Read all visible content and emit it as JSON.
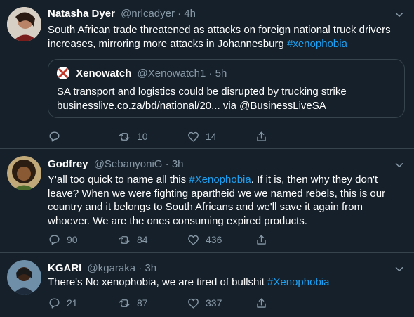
{
  "tweets": [
    {
      "name": "Natasha Dyer",
      "handle": "@nrlcadyer",
      "dot": "·",
      "time": "4h",
      "text_plain": "South African trade threatened as attacks on foreign national truck drivers increases, mirroring more attacks in Johannesburg ",
      "hashtag": "#xenophobia",
      "quote": {
        "name": "Xenowatch",
        "handle": "@Xenowatch1",
        "dot": "·",
        "time": "5h",
        "line1": "SA transport and logistics could be disrupted by trucking strike",
        "line2": "businesslive.co.za/bd/national/20... via @BusinessLiveSA"
      },
      "reply_count": "",
      "retweet_count": "10",
      "like_count": "14"
    },
    {
      "name": "Godfrey",
      "handle": "@SebanyoniG",
      "dot": "·",
      "time": "3h",
      "text_before": "Y'all too quick to name all this  ",
      "hashtag": "#Xenophobia",
      "text_after": ". If it is, then why they don't leave? When we were fighting apartheid we we named rebels, this is our country and it belongs to South Africans and we'll save it again from whoever. We are the ones consuming expired products.",
      "reply_count": "90",
      "retweet_count": "84",
      "like_count": "436"
    },
    {
      "name": "KGARI",
      "handle": "@kgaraka",
      "dot": "·",
      "time": "3h",
      "text_before": "There's No xenophobia, we are tired of bullshit ",
      "hashtag": "#Xenophobia",
      "reply_count": "21",
      "retweet_count": "87",
      "like_count": "337"
    }
  ],
  "colors": {
    "background": "#15202b",
    "border": "#38444d",
    "muted": "#8899a6",
    "accent": "#1da1f2"
  },
  "icons": [
    "reply-icon",
    "retweet-icon",
    "like-icon",
    "share-icon",
    "chevron-down-icon"
  ]
}
